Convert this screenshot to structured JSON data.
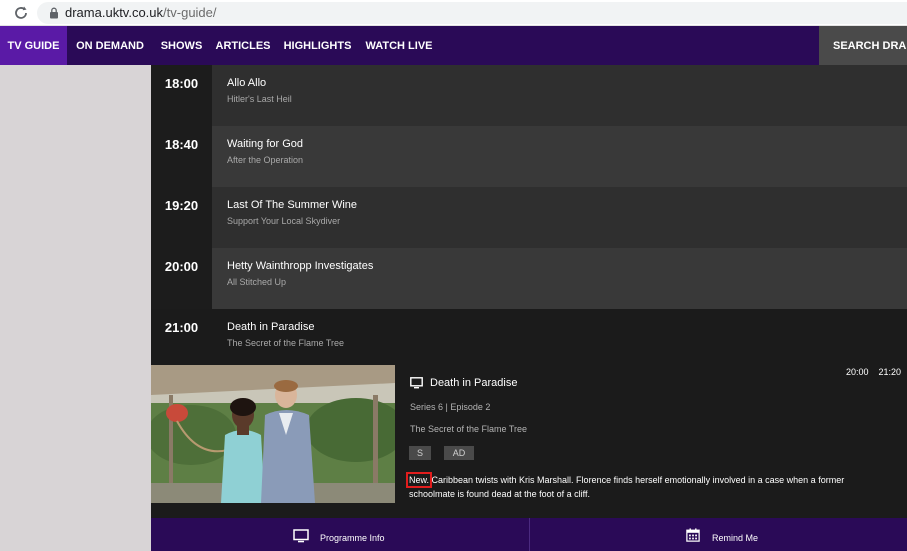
{
  "browser": {
    "url_host": "drama.uktv.co.uk",
    "url_path": "/tv-guide/"
  },
  "nav": {
    "items": [
      {
        "label": "TV GUIDE",
        "active": true
      },
      {
        "label": "ON DEMAND",
        "active": false
      },
      {
        "label": "SHOWS",
        "active": false
      },
      {
        "label": "ARTICLES",
        "active": false
      },
      {
        "label": "HIGHLIGHTS",
        "active": false
      },
      {
        "label": "WATCH LIVE",
        "active": false
      }
    ],
    "search_label": "SEARCH DRAMA"
  },
  "guide": {
    "slots": [
      {
        "time": "18:00",
        "title": "Allo Allo",
        "episode": "Hitler's Last Heil"
      },
      {
        "time": "18:40",
        "title": "Waiting for God",
        "episode": "After the Operation"
      },
      {
        "time": "19:20",
        "title": "Last Of The Summer Wine",
        "episode": "Support Your Local Skydiver"
      },
      {
        "time": "20:00",
        "title": "Hetty Wainthropp Investigates",
        "episode": "All Stitched Up"
      },
      {
        "time": "21:00",
        "title": "Death in Paradise",
        "episode": "The Secret of the Flame Tree"
      }
    ]
  },
  "detail": {
    "title": "Death in Paradise",
    "start_time": "20:00",
    "end_time": "21:20",
    "series_episode": "Series 6 | Episode 2",
    "episode_title": "The Secret of the Flame Tree",
    "badges": [
      "S",
      "AD"
    ],
    "desc_new": "New.",
    "description": " Caribbean twists with Kris Marshall. Florence finds herself emotionally involved in a case when a former schoolmate is found dead at the foot of a cliff."
  },
  "actions": {
    "programme_info": "Programme Info",
    "remind_me": "Remind Me"
  },
  "icons": {
    "reload": "reload-icon",
    "lock": "lock-icon",
    "tv": "tv-icon",
    "calendar": "calendar-icon"
  },
  "colors": {
    "nav_bg": "#2a0a57",
    "nav_active": "#5a1aa6",
    "highlight_box": "#e11d1d"
  }
}
